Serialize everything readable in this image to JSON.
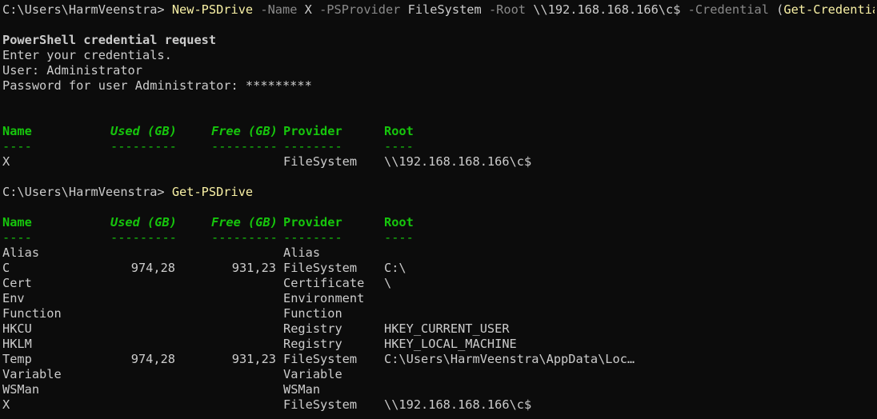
{
  "window": {
    "prompt": "C:\\Users\\HarmVeenstra>"
  },
  "command1": {
    "cmdlet": "New-PSDrive",
    "p_name": "-Name",
    "v_name": "X",
    "p_provider": "-PSProvider",
    "v_provider": "FileSystem",
    "p_root": "-Root",
    "v_root": "\\\\192.168.168.166\\c$",
    "p_cred": "-Credential",
    "paren_open": "(",
    "inner_cmdlet": "Get-Credential",
    "paren_close": ")"
  },
  "credential": {
    "title": "PowerShell credential request",
    "enter": "Enter your credentials.",
    "user": "User: Administrator",
    "password": "Password for user Administrator: *********"
  },
  "headers": {
    "name": "Name",
    "used": "Used (GB)",
    "free": "Free (GB)",
    "provider": "Provider",
    "root": "Root",
    "sep_name": "----",
    "sep_used": "---------",
    "sep_free": "---------",
    "sep_provider": "--------",
    "sep_root": "----"
  },
  "result1": [
    {
      "name": "X",
      "used": "",
      "free": "",
      "provider": "FileSystem",
      "root": "\\\\192.168.168.166\\c$"
    }
  ],
  "command2": {
    "cmdlet": "Get-PSDrive"
  },
  "result2": [
    {
      "name": "Alias",
      "used": "",
      "free": "",
      "provider": "Alias",
      "root": ""
    },
    {
      "name": "C",
      "used": "974,28",
      "free": "931,23",
      "provider": "FileSystem",
      "root": "C:\\"
    },
    {
      "name": "Cert",
      "used": "",
      "free": "",
      "provider": "Certificate",
      "root": "\\"
    },
    {
      "name": "Env",
      "used": "",
      "free": "",
      "provider": "Environment",
      "root": ""
    },
    {
      "name": "Function",
      "used": "",
      "free": "",
      "provider": "Function",
      "root": ""
    },
    {
      "name": "HKCU",
      "used": "",
      "free": "",
      "provider": "Registry",
      "root": "HKEY_CURRENT_USER"
    },
    {
      "name": "HKLM",
      "used": "",
      "free": "",
      "provider": "Registry",
      "root": "HKEY_LOCAL_MACHINE"
    },
    {
      "name": "Temp",
      "used": "974,28",
      "free": "931,23",
      "provider": "FileSystem",
      "root": "C:\\Users\\HarmVeenstra\\AppData\\Loca…"
    },
    {
      "name": "Variable",
      "used": "",
      "free": "",
      "provider": "Variable",
      "root": ""
    },
    {
      "name": "WSMan",
      "used": "",
      "free": "",
      "provider": "WSMan",
      "root": ""
    },
    {
      "name": "X",
      "used": "",
      "free": "",
      "provider": "FileSystem",
      "root": "\\\\192.168.168.166\\c$"
    }
  ],
  "colors": {
    "background": "#0c0c0c",
    "text": "#cccccc",
    "cmdlet": "#f9f1a5",
    "parameter": "#8a8a8a",
    "table_header": "#16c60c"
  }
}
